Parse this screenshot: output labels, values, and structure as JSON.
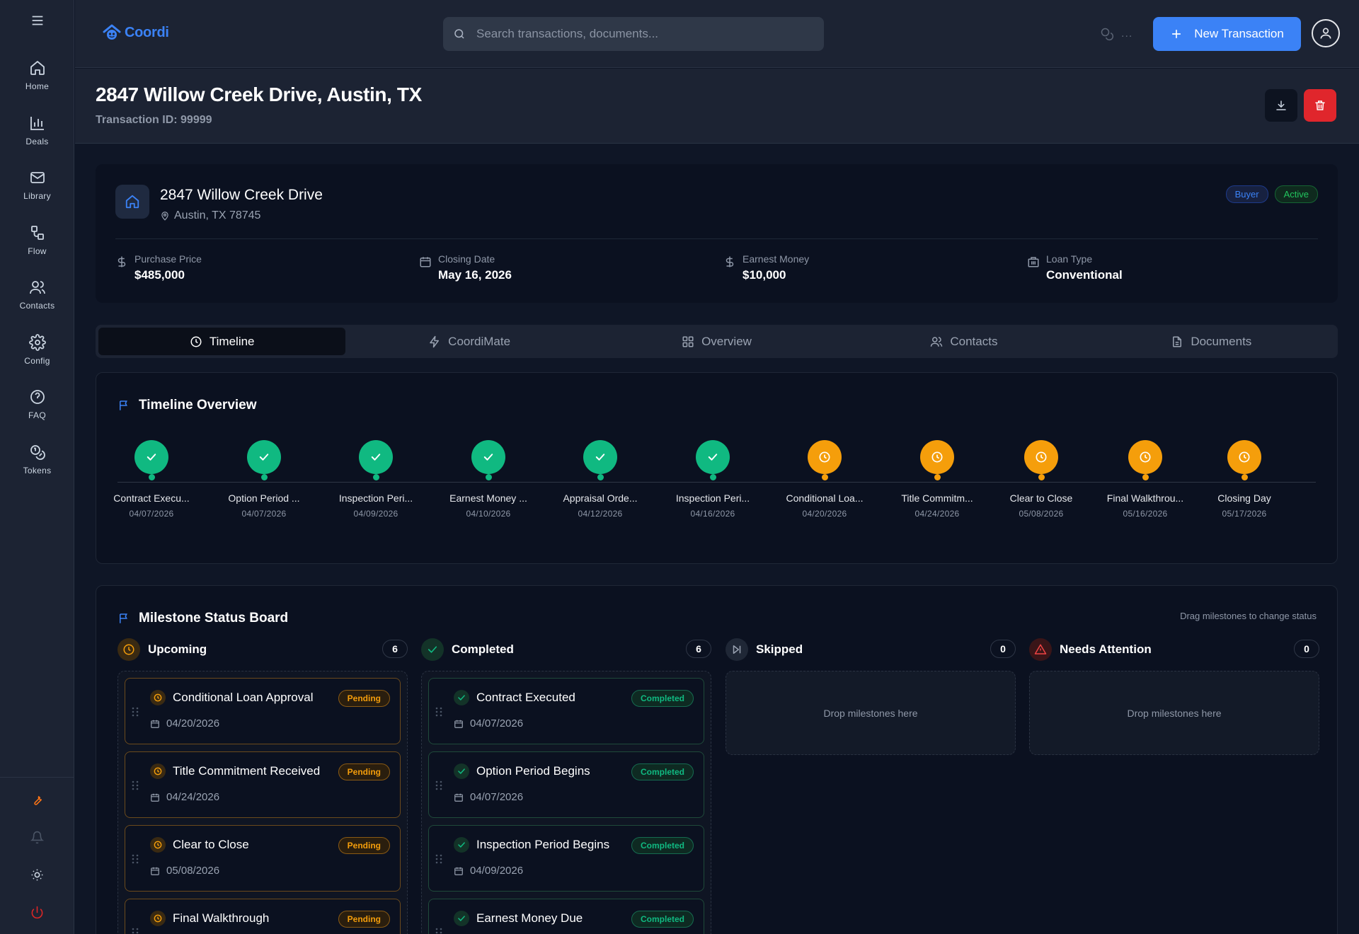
{
  "sidebar": {
    "items": [
      {
        "label": "Home",
        "icon": "home-icon"
      },
      {
        "label": "Deals",
        "icon": "bar-chart-icon"
      },
      {
        "label": "Library",
        "icon": "mail-icon"
      },
      {
        "label": "Flow",
        "icon": "flow-icon"
      },
      {
        "label": "Contacts",
        "icon": "users-icon"
      },
      {
        "label": "Config",
        "icon": "gear-icon"
      },
      {
        "label": "FAQ",
        "icon": "help-icon"
      },
      {
        "label": "Tokens",
        "icon": "tokens-icon"
      }
    ],
    "bottom_icons": [
      "wrench-icon",
      "bell-icon",
      "sun-icon",
      "power-icon"
    ]
  },
  "topbar": {
    "logo": "Coordi",
    "search_placeholder": "Search transactions, documents...",
    "util_ellipsis": "...",
    "new_button": "New Transaction"
  },
  "header": {
    "title": "2847 Willow Creek Drive, Austin, TX",
    "transaction_id": "Transaction ID: 99999"
  },
  "property": {
    "name": "2847 Willow Creek Drive",
    "location": "Austin, TX 78745",
    "badges": {
      "role": "Buyer",
      "status": "Active"
    },
    "stats": [
      {
        "label": "Purchase Price",
        "value": "$485,000"
      },
      {
        "label": "Closing Date",
        "value": "May 16, 2026"
      },
      {
        "label": "Earnest Money",
        "value": "$10,000"
      },
      {
        "label": "Loan Type",
        "value": "Conventional"
      }
    ]
  },
  "tabs": [
    {
      "label": "Timeline",
      "active": true
    },
    {
      "label": "CoordiMate"
    },
    {
      "label": "Overview"
    },
    {
      "label": "Contacts"
    },
    {
      "label": "Documents"
    }
  ],
  "timeline": {
    "title": "Timeline Overview",
    "milestones": [
      {
        "label": "Contract Execu...",
        "date": "04/07/2026",
        "status": "done"
      },
      {
        "label": "Option Period ...",
        "date": "04/07/2026",
        "status": "done"
      },
      {
        "label": "Inspection Peri...",
        "date": "04/09/2026",
        "status": "done"
      },
      {
        "label": "Earnest Money ...",
        "date": "04/10/2026",
        "status": "done"
      },
      {
        "label": "Appraisal Orde...",
        "date": "04/12/2026",
        "status": "done"
      },
      {
        "label": "Inspection Peri...",
        "date": "04/16/2026",
        "status": "done"
      },
      {
        "label": "Conditional Loa...",
        "date": "04/20/2026",
        "status": "pending"
      },
      {
        "label": "Title Commitm...",
        "date": "04/24/2026",
        "status": "pending"
      },
      {
        "label": "Clear to Close",
        "date": "05/08/2026",
        "status": "pending"
      },
      {
        "label": "Final Walkthrou...",
        "date": "05/16/2026",
        "status": "pending"
      },
      {
        "label": "Closing Day",
        "date": "05/17/2026",
        "status": "pending"
      }
    ]
  },
  "board": {
    "title": "Milestone Status Board",
    "hint": "Drag milestones to change status",
    "columns": [
      {
        "title": "Upcoming",
        "count": "6",
        "color": "#f59e0b",
        "cards": [
          {
            "title": "Conditional Loan Approval",
            "date": "04/20/2026",
            "status": "Pending"
          },
          {
            "title": "Title Commitment Received",
            "date": "04/24/2026",
            "status": "Pending"
          },
          {
            "title": "Clear to Close",
            "date": "05/08/2026",
            "status": "Pending"
          },
          {
            "title": "Final Walkthrough",
            "date": "",
            "status": "Pending"
          }
        ]
      },
      {
        "title": "Completed",
        "count": "6",
        "color": "#10b981",
        "cards": [
          {
            "title": "Contract Executed",
            "date": "04/07/2026",
            "status": "Completed"
          },
          {
            "title": "Option Period Begins",
            "date": "04/07/2026",
            "status": "Completed"
          },
          {
            "title": "Inspection Period Begins",
            "date": "04/09/2026",
            "status": "Completed"
          },
          {
            "title": "Earnest Money Due",
            "date": "",
            "status": "Completed"
          }
        ]
      },
      {
        "title": "Skipped",
        "count": "0",
        "color": "#9aa3b2",
        "empty_text": "Drop milestones here"
      },
      {
        "title": "Needs Attention",
        "count": "0",
        "color": "#ef4444",
        "empty_text": "Drop milestones here"
      }
    ]
  },
  "colors": {
    "accent": "#3b82f6",
    "success": "#10b981",
    "warning": "#f59e0b",
    "danger": "#e0262c"
  }
}
